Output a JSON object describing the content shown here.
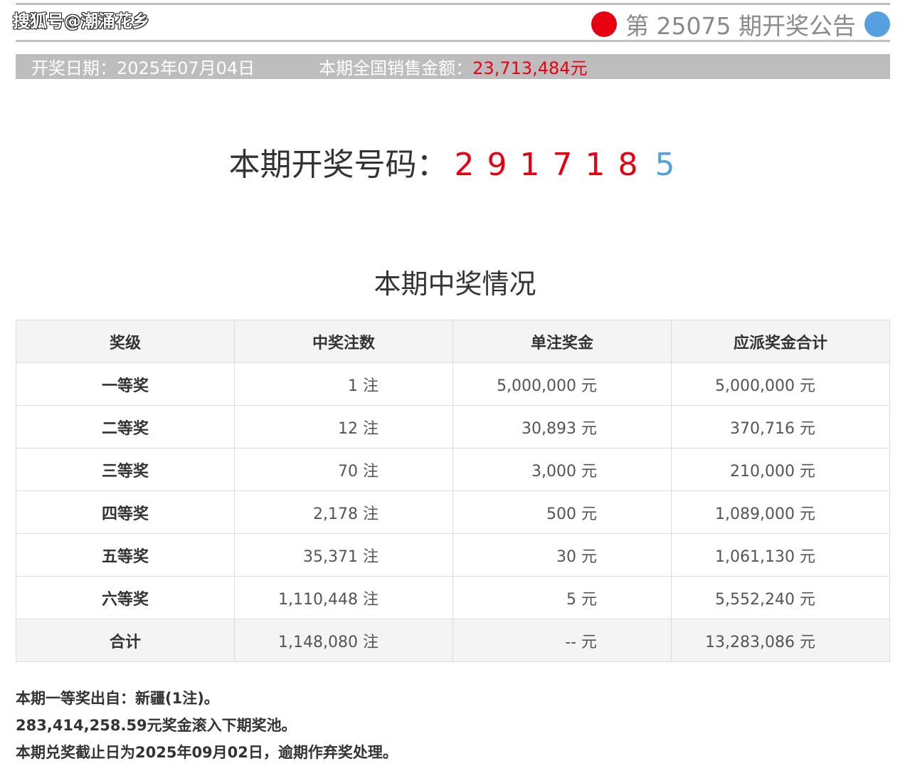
{
  "watermark": "搜狐号@潮涌花乡",
  "header": {
    "issue_title": "第 25075 期开奖公告",
    "ball_left_color": "#e60012",
    "ball_right_color": "#56a0e0"
  },
  "info_bar": {
    "date": "开奖日期：2025年07月04日",
    "sales_label": "本期全国销售金额：",
    "sales_value": "23,713,484元"
  },
  "draw": {
    "label": "本期开奖号码：",
    "numbers": [
      "2",
      "9",
      "1",
      "7",
      "1",
      "8"
    ],
    "special": "5"
  },
  "section_title": "本期中奖情况",
  "table": {
    "headers": [
      "奖级",
      "中奖注数",
      "单注奖金",
      "应派奖金合计"
    ],
    "rows": [
      {
        "level": "一等奖",
        "count": "1 注",
        "single": "5,000,000 元",
        "total": "5,000,000 元"
      },
      {
        "level": "二等奖",
        "count": "12 注",
        "single": "30,893 元",
        "total": "370,716 元"
      },
      {
        "level": "三等奖",
        "count": "70 注",
        "single": "3,000 元",
        "total": "210,000 元"
      },
      {
        "level": "四等奖",
        "count": "2,178 注",
        "single": "500 元",
        "total": "1,089,000 元"
      },
      {
        "level": "五等奖",
        "count": "35,371 注",
        "single": "30 元",
        "total": "1,061,130 元"
      },
      {
        "level": "六等奖",
        "count": "1,110,448 注",
        "single": "5 元",
        "total": "5,552,240 元"
      },
      {
        "level": "合计",
        "count": "1,148,080 注",
        "single": "-- 元",
        "total": "13,283,086 元"
      }
    ]
  },
  "notes": [
    "本期一等奖出自：新疆(1注)。",
    "283,414,258.59元奖金滚入下期奖池。",
    "本期兑奖截止日为2025年09月02日，逾期作弃奖处理。"
  ]
}
